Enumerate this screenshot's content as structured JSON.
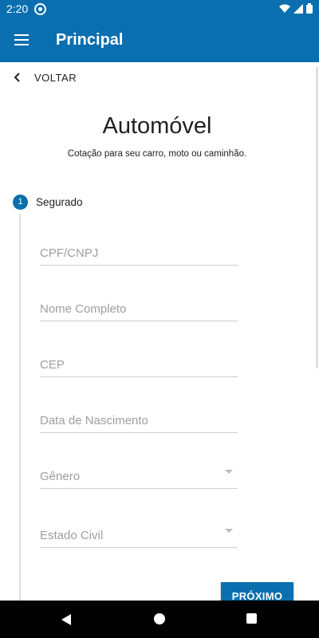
{
  "status_bar": {
    "time": "2:20"
  },
  "app_bar": {
    "title": "Principal"
  },
  "back": {
    "label": "VOLTAR"
  },
  "header": {
    "title": "Automóvel",
    "subtitle": "Cotação para seu carro, moto ou caminhão."
  },
  "step": {
    "number": "1",
    "label": "Segurado"
  },
  "form": {
    "cpf": {
      "placeholder": "CPF/CNPJ",
      "value": ""
    },
    "name": {
      "placeholder": "Nome Completo",
      "value": ""
    },
    "cep": {
      "placeholder": "CEP",
      "value": ""
    },
    "birthdate": {
      "placeholder": "Data de Nascimento",
      "value": ""
    },
    "gender": {
      "placeholder": "Gênero"
    },
    "marital": {
      "placeholder": "Estado Civil"
    }
  },
  "actions": {
    "next_label": "PRÓXIMO"
  },
  "colors": {
    "primary": "#0a6fae"
  }
}
